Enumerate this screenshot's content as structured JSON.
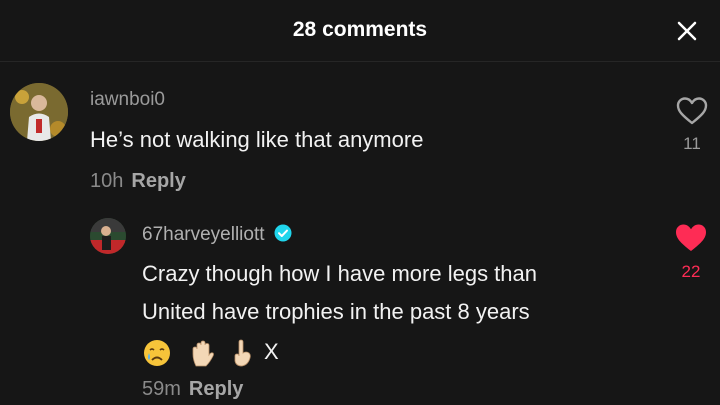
{
  "header": {
    "title": "28 comments"
  },
  "comments": [
    {
      "username": "iawnboi0",
      "text": "He’s not walking like that anymore",
      "time": "10h",
      "reply_label": "Reply",
      "like_count": "11",
      "liked": false,
      "avatar_icon": "user-avatar"
    }
  ],
  "reply": {
    "username": "67harveyelliott",
    "verified": true,
    "text_line1": "Crazy though how I have more legs than",
    "text_line2": "United have trophies in the past 8 years",
    "emojis": [
      "crying-face",
      "raised-hand",
      "index-pointing-up"
    ],
    "emoji_suffix": "X",
    "time": "59m",
    "reply_label": "Reply",
    "like_count": "22",
    "liked": true
  },
  "colors": {
    "background": "#161616",
    "liked_red": "#fe2c55",
    "verified_blue": "#20d5ec"
  }
}
